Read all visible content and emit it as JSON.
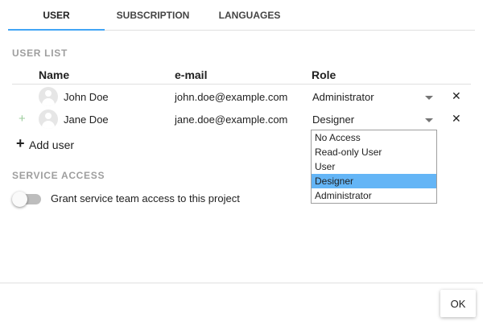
{
  "tabs": [
    {
      "label": "USER",
      "active": true
    },
    {
      "label": "SUBSCRIPTION",
      "active": false
    },
    {
      "label": "LANGUAGES",
      "active": false
    }
  ],
  "user_list": {
    "title": "USER LIST",
    "columns": [
      "Name",
      "e-mail",
      "Role"
    ],
    "rows": [
      {
        "name": "John Doe",
        "email": "john.doe@example.com",
        "role": "Administrator",
        "remove_icon": "close-icon"
      },
      {
        "name": "Jane Doe",
        "email": "jane.doe@example.com",
        "role": "Designer",
        "remove_icon": "close-icon",
        "row_icon": "plus-icon"
      }
    ],
    "add_label": "Add user",
    "add_icon": "plus-icon"
  },
  "role_dropdown": {
    "options": [
      "No Access",
      "Read-only User",
      "User",
      "Designer",
      "Administrator"
    ],
    "selected": "Designer",
    "highlight_color": "#64b5f6"
  },
  "service_access": {
    "title": "SERVICE ACCESS",
    "toggle_label": "Grant service team access to this project",
    "toggle_on": false
  },
  "footer": {
    "ok_label": "OK"
  },
  "colors": {
    "accent": "#42a5f5",
    "section_title": "#9e9e9e"
  }
}
